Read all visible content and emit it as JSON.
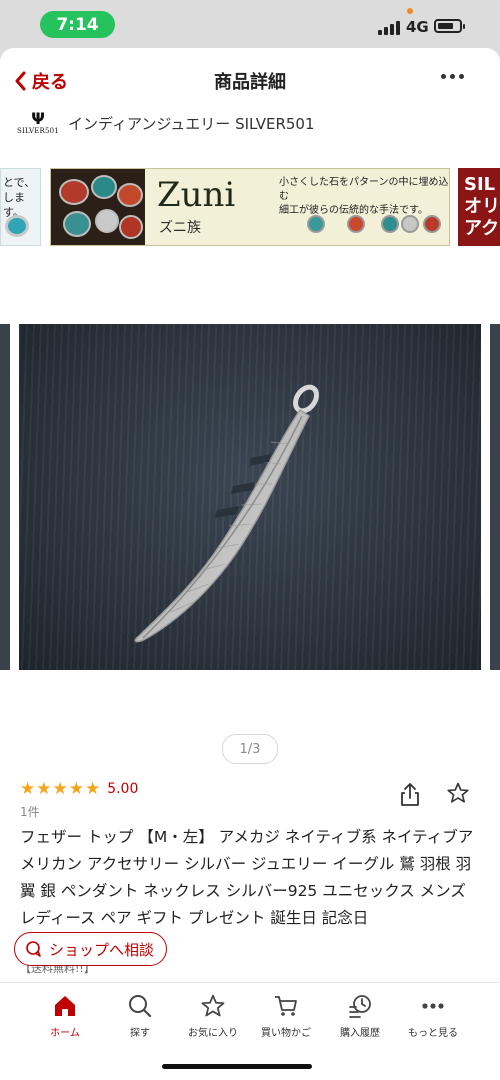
{
  "status_bar": {
    "time": "7:14",
    "network": "4G"
  },
  "nav": {
    "back_label": "戻る",
    "title": "商品詳細"
  },
  "shop": {
    "logo_text": "SILVER501",
    "name": "インディアンジュエリー SILVER501"
  },
  "banners": {
    "left_text": "とで、 します。",
    "main_title": "Zuni",
    "main_subtitle": "ズニ族",
    "main_desc_1": "小さくした石をパターンの中に埋め込む",
    "main_desc_2": "細工が彼らの伝統的な手法です。",
    "right_text": "SIL オリ アク"
  },
  "gallery": {
    "pager": "1/3",
    "current_index": 1,
    "total": 3
  },
  "rating": {
    "stars": "★★★★★",
    "value": "5.00",
    "count": "1件"
  },
  "product": {
    "title": "フェザー トップ 【M・左】 アメカジ ネイティブ系 ネイティブアメリカン アクセサリー シルバー ジュエリー イーグル 鷲 羽根 羽 翼 銀 ペンダント ネックレス シルバー925 ユニセックス メンズ レディース ペア ギフト プレゼント 誕生日 記念日",
    "cut_line": "【送料無料!!】"
  },
  "consult_button": "ショップへ相談",
  "tabs": [
    {
      "label": "ホーム",
      "icon": "home-icon",
      "active": true
    },
    {
      "label": "探す",
      "icon": "search-icon"
    },
    {
      "label": "お気に入り",
      "icon": "star-icon"
    },
    {
      "label": "買い物かご",
      "icon": "cart-icon"
    },
    {
      "label": "購入履歴",
      "icon": "history-icon"
    },
    {
      "label": "もっと見る",
      "icon": "more-icon"
    }
  ],
  "colors": {
    "brand_red": "#bf0000",
    "star": "#f3a51b",
    "status_green": "#25c25e"
  }
}
